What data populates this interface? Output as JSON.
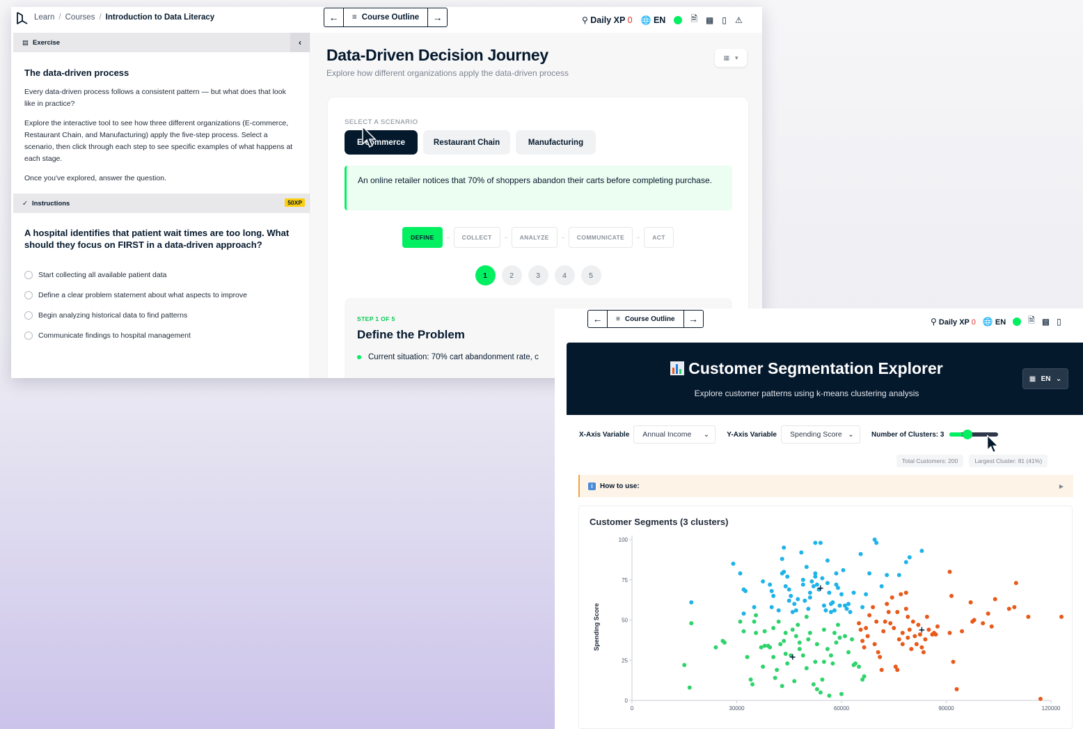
{
  "window1": {
    "breadcrumb": [
      "Learn",
      "Courses",
      "Introduction to Data Literacy"
    ],
    "nav": {
      "outline_label": "Course Outline",
      "daily_xp_label": "Daily XP",
      "daily_xp_value": "0",
      "lang": "EN"
    },
    "exercise": {
      "tab_label": "Exercise",
      "heading": "The data-driven process",
      "paragraphs": [
        "Every data-driven process follows a consistent pattern — but what does that look like in practice?",
        "Explore the interactive tool to see how three different organizations (E-commerce, Restaurant Chain, and Manufacturing) apply the five-step process. Select a scenario, then click through each step to see specific examples of what happens at each stage.",
        "Once you've explored, answer the question."
      ]
    },
    "instructions": {
      "tab_label": "Instructions",
      "xp": "50XP",
      "question": "A hospital identifies that patient wait times are too long. What should they focus on FIRST in a data-driven approach?",
      "options": [
        "Start collecting all available patient data",
        "Define a clear problem statement about what aspects to improve",
        "Begin analyzing historical data to find patterns",
        "Communicate findings to hospital management"
      ]
    },
    "main": {
      "title": "Data-Driven Decision Journey",
      "subtitle": "Explore how different organizations apply the data-driven process",
      "select_label": "SELECT A SCENARIO",
      "scenarios": [
        "E-commerce",
        "Restaurant Chain",
        "Manufacturing"
      ],
      "active_scenario": "E-commerce",
      "scenario_text": "An online retailer notices that 70% of shoppers abandon their carts before completing purchase.",
      "steps": [
        "DEFINE",
        "COLLECT",
        "ANALYZE",
        "COMMUNICATE",
        "ACT"
      ],
      "step_numbers": [
        "1",
        "2",
        "3",
        "4",
        "5"
      ],
      "step_label": "STEP 1 OF 5",
      "step_title": "Define the Problem",
      "step_item": "Current situation: 70% cart abandonment rate, c"
    }
  },
  "window2": {
    "nav": {
      "outline_label": "Course Outline",
      "daily_xp_label": "Daily XP",
      "daily_xp_value": "0",
      "lang": "EN"
    },
    "banner": {
      "title": "Customer Segmentation Explorer",
      "subtitle": "Explore customer patterns using k-means clustering analysis",
      "lang": "EN"
    },
    "controls": {
      "x_label": "X-Axis Variable",
      "x_value": "Annual Income",
      "y_label": "Y-Axis Variable",
      "y_value": "Spending Score",
      "clusters_label": "Number of Clusters: 3",
      "clusters_value": 3,
      "clusters_min": 2,
      "clusters_max": 8
    },
    "stats": {
      "total": "Total Customers: 200",
      "largest": "Largest Cluster: 81 (41%)"
    },
    "howto_label": "How to use:",
    "colors": {
      "cluster1": "#1fb3e8",
      "cluster2": "#e8591a",
      "cluster3": "#2fd36b",
      "accent": "#03ef62",
      "navy": "#05192d"
    }
  },
  "chart_data": {
    "type": "scatter",
    "title": "Customer Segments (3 clusters)",
    "xlabel": "",
    "ylabel": "Spending Score",
    "xlim": [
      0,
      120000
    ],
    "ylim": [
      0,
      100
    ],
    "xticks": [
      0,
      30000,
      60000,
      90000,
      120000
    ],
    "yticks": [
      0,
      25,
      50,
      75,
      100
    ],
    "series": [
      {
        "color": "#1fb3e8",
        "points": [
          [
            17000,
            61
          ],
          [
            29000,
            85
          ],
          [
            31000,
            79
          ],
          [
            32000,
            69
          ],
          [
            32500,
            68
          ],
          [
            32000,
            54
          ],
          [
            35000,
            58
          ],
          [
            37500,
            74
          ],
          [
            39500,
            72
          ],
          [
            40000,
            68
          ],
          [
            40500,
            65
          ],
          [
            40000,
            58
          ],
          [
            42000,
            56
          ],
          [
            43000,
            79
          ],
          [
            43500,
            80
          ],
          [
            43000,
            88
          ],
          [
            43500,
            95
          ],
          [
            44000,
            71
          ],
          [
            44500,
            77
          ],
          [
            45000,
            69
          ],
          [
            45500,
            65
          ],
          [
            46000,
            55
          ],
          [
            46500,
            60
          ],
          [
            47000,
            56
          ],
          [
            48500,
            92
          ],
          [
            49000,
            75
          ],
          [
            49000,
            72
          ],
          [
            49500,
            62
          ],
          [
            50000,
            83
          ],
          [
            50500,
            57
          ],
          [
            51000,
            67
          ],
          [
            51500,
            74
          ],
          [
            52000,
            71
          ],
          [
            52500,
            79
          ],
          [
            52500,
            77
          ],
          [
            52500,
            98
          ],
          [
            53000,
            72
          ],
          [
            53500,
            69
          ],
          [
            54000,
            98
          ],
          [
            54500,
            76
          ],
          [
            55000,
            59
          ],
          [
            55500,
            56
          ],
          [
            56000,
            87
          ],
          [
            56000,
            73
          ],
          [
            56500,
            67
          ],
          [
            57000,
            60
          ],
          [
            57500,
            61
          ],
          [
            57000,
            55
          ],
          [
            58000,
            56
          ],
          [
            58500,
            79
          ],
          [
            58500,
            72
          ],
          [
            59000,
            70
          ],
          [
            59500,
            59
          ],
          [
            60000,
            66
          ],
          [
            60500,
            81
          ],
          [
            61000,
            59
          ],
          [
            61500,
            57
          ],
          [
            62000,
            60
          ],
          [
            62500,
            55
          ],
          [
            63500,
            67
          ],
          [
            65500,
            91
          ],
          [
            67000,
            66
          ],
          [
            68000,
            79
          ],
          [
            69500,
            100
          ],
          [
            70000,
            98
          ],
          [
            71500,
            71
          ],
          [
            73000,
            78
          ],
          [
            76500,
            78
          ],
          [
            78500,
            86
          ],
          [
            79500,
            89
          ],
          [
            83000,
            93
          ],
          [
            66000,
            58
          ],
          [
            51000,
            64
          ],
          [
            47500,
            63
          ],
          [
            45000,
            62
          ]
        ]
      },
      {
        "color": "#e8591a",
        "points": [
          [
            65000,
            48
          ],
          [
            65500,
            44
          ],
          [
            66000,
            37
          ],
          [
            66500,
            33
          ],
          [
            67000,
            45
          ],
          [
            67500,
            40
          ],
          [
            68000,
            53
          ],
          [
            69500,
            35
          ],
          [
            70500,
            30
          ],
          [
            71000,
            27
          ],
          [
            71500,
            19
          ],
          [
            72000,
            43
          ],
          [
            73000,
            60
          ],
          [
            73500,
            55
          ],
          [
            74000,
            48
          ],
          [
            74500,
            64
          ],
          [
            75000,
            45
          ],
          [
            75500,
            21
          ],
          [
            76000,
            19
          ],
          [
            76500,
            38
          ],
          [
            77000,
            66
          ],
          [
            77500,
            42
          ],
          [
            77500,
            35
          ],
          [
            78500,
            57
          ],
          [
            78500,
            67
          ],
          [
            79000,
            39
          ],
          [
            79500,
            44
          ],
          [
            80000,
            32
          ],
          [
            80500,
            49
          ],
          [
            81000,
            40
          ],
          [
            81500,
            35
          ],
          [
            82000,
            47
          ],
          [
            82500,
            41
          ],
          [
            83000,
            33
          ],
          [
            83500,
            30
          ],
          [
            84000,
            38
          ],
          [
            85000,
            44
          ],
          [
            86000,
            41
          ],
          [
            86500,
            42
          ],
          [
            87000,
            41
          ],
          [
            87500,
            46
          ],
          [
            91000,
            80
          ],
          [
            91500,
            65
          ],
          [
            92000,
            24
          ],
          [
            93000,
            7
          ],
          [
            94500,
            43
          ],
          [
            97000,
            61
          ],
          [
            97500,
            49
          ],
          [
            102000,
            54
          ],
          [
            103000,
            46
          ],
          [
            104000,
            63
          ],
          [
            108000,
            57
          ],
          [
            109500,
            58
          ],
          [
            110000,
            73
          ],
          [
            113500,
            52
          ],
          [
            117000,
            1
          ],
          [
            123000,
            52
          ],
          [
            100500,
            48
          ],
          [
            98000,
            50
          ],
          [
            91000,
            42
          ],
          [
            84500,
            52
          ],
          [
            69000,
            58
          ],
          [
            76000,
            55
          ],
          [
            79000,
            52
          ],
          [
            70000,
            49
          ],
          [
            72500,
            49
          ]
        ]
      },
      {
        "color": "#2fd36b",
        "points": [
          [
            15000,
            22
          ],
          [
            16500,
            8
          ],
          [
            17000,
            48
          ],
          [
            24000,
            33
          ],
          [
            26000,
            37
          ],
          [
            26500,
            36
          ],
          [
            31000,
            49
          ],
          [
            32000,
            43
          ],
          [
            33000,
            27
          ],
          [
            34000,
            13
          ],
          [
            34500,
            10
          ],
          [
            35000,
            49
          ],
          [
            35500,
            42
          ],
          [
            35500,
            53
          ],
          [
            37000,
            33
          ],
          [
            37500,
            21
          ],
          [
            38000,
            34
          ],
          [
            39000,
            34
          ],
          [
            39500,
            33
          ],
          [
            40500,
            27
          ],
          [
            41000,
            14
          ],
          [
            41500,
            19
          ],
          [
            42000,
            49
          ],
          [
            42500,
            35
          ],
          [
            43000,
            9
          ],
          [
            43500,
            37
          ],
          [
            44000,
            29
          ],
          [
            44500,
            23
          ],
          [
            45500,
            28
          ],
          [
            46000,
            44
          ],
          [
            46500,
            12
          ],
          [
            47500,
            47
          ],
          [
            48000,
            36
          ],
          [
            49000,
            28
          ],
          [
            50000,
            20
          ],
          [
            50500,
            38
          ],
          [
            51000,
            42
          ],
          [
            52000,
            10
          ],
          [
            52500,
            24
          ],
          [
            53000,
            7
          ],
          [
            54000,
            5
          ],
          [
            54500,
            13
          ],
          [
            55000,
            24
          ],
          [
            56000,
            32
          ],
          [
            56500,
            3
          ],
          [
            57000,
            28
          ],
          [
            57500,
            23
          ],
          [
            58000,
            42
          ],
          [
            58500,
            36
          ],
          [
            59000,
            47
          ],
          [
            59500,
            39
          ],
          [
            60000,
            4
          ],
          [
            61000,
            40
          ],
          [
            62000,
            30
          ],
          [
            63000,
            38
          ],
          [
            63500,
            22
          ],
          [
            64000,
            23
          ],
          [
            65000,
            21
          ],
          [
            66000,
            13
          ],
          [
            66500,
            15
          ],
          [
            44000,
            42
          ],
          [
            48000,
            32
          ],
          [
            50000,
            52
          ],
          [
            53000,
            35
          ],
          [
            55000,
            44
          ],
          [
            38000,
            43
          ],
          [
            40500,
            45
          ],
          [
            47000,
            40
          ]
        ]
      }
    ],
    "centroids": [
      [
        54000,
        70
      ],
      [
        83000,
        44
      ],
      [
        46000,
        27
      ]
    ]
  }
}
